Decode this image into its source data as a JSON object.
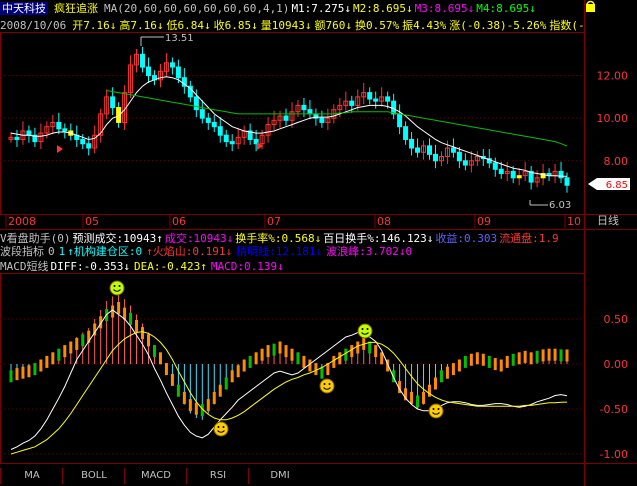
{
  "header": {
    "stock_name": "中天科技",
    "indicator": "疯狂追涨",
    "ma_params": "MA(20,60,60,60,60,60,60,4,1)",
    "m1": "M1:7.275↓",
    "m2": "M2:8.695↓",
    "m3": "M3:8.695↓",
    "m4": "M4:8.695↓",
    "date": "2008/10/06",
    "open": "开7.16↓",
    "high": "高7.16↓",
    "low": "低6.84↓",
    "close": "收6.85↓",
    "volume": "量10943↓",
    "amount": "额760↓",
    "turnover": "换0.57%",
    "amplitude": "振4.43%",
    "change": "涨(-0.38)-5.26%",
    "index_label": "指数(-"
  },
  "info1": {
    "label": "V看盘助手(0)",
    "forecast": "预测成交:10943↑",
    "deal": "成交:10943↓",
    "turnover_rate": "换手率%:0.568↓",
    "hundred_day": "百日换手%:146.123↓",
    "profit": "收益:0.303",
    "float_shares": "流通盘:1.9"
  },
  "info2": {
    "label": "波段指标",
    "zero": "0",
    "one": "1",
    "inst_build": "↑机构建仓区:0",
    "fire": "↑火焰山:0.191↓",
    "bottom": "精明线:12.181↓",
    "wave_peak": "波浪峰:3.702↓0"
  },
  "macd_info": {
    "label": "MACD短线",
    "diff": "DIFF:-0.353↓",
    "dea": "DEA:-0.423↑",
    "macd": "MACD:0.139↓"
  },
  "tabs": [
    "MA",
    "BOLL",
    "MACD",
    "RSI",
    "DMI"
  ],
  "right_label": "日线",
  "price_tag": "6.85",
  "annotations": {
    "high": "13.51",
    "low": "6.03"
  },
  "colors": {
    "up": "#ff3232",
    "down": "#00ffff",
    "ma_white": "#ffffff",
    "ma_green": "#00c000",
    "macd_white": "#ffffff",
    "macd_yellow": "#ffff00"
  },
  "chart_data": [
    {
      "type": "candlestick",
      "yticks": [
        "12.00",
        "10.00",
        "8.00"
      ],
      "ylim": [
        5.5,
        14.0
      ],
      "xticks": [
        "2008",
        "05",
        "06",
        "07",
        "08",
        "09",
        "10"
      ],
      "series": [
        {
          "values": [
            9.1,
            9.0,
            9.4,
            9.2,
            8.9,
            9.3,
            9.6,
            9.8,
            9.5,
            9.4,
            9.2,
            9.0,
            8.8,
            8.6,
            9.2,
            10.2,
            11.0,
            10.5,
            9.8,
            11.2,
            12.5,
            13.0,
            12.4,
            12.0,
            11.8,
            12.2,
            12.6,
            12.4,
            11.9,
            11.5,
            11.0,
            10.4,
            10.0,
            9.8,
            9.6,
            9.2,
            8.9,
            8.8,
            9.1,
            9.4,
            9.0,
            8.8,
            9.2,
            9.7,
            9.9,
            10.1,
            9.9,
            10.3,
            10.6,
            10.4,
            10.2,
            10.0,
            9.8,
            10.0,
            10.4,
            10.6,
            10.8,
            10.6,
            11.0,
            11.2,
            10.9,
            10.8,
            11.0,
            10.8,
            10.2,
            9.6,
            9.0,
            8.6,
            8.4,
            8.7,
            8.3,
            8.0,
            8.2,
            8.6,
            8.4,
            8.0,
            7.8,
            8.0,
            8.2,
            8.1,
            7.9,
            7.6,
            7.4,
            7.5,
            7.2,
            7.3,
            7.5,
            7.0,
            7.2,
            7.4,
            7.3,
            7.5,
            7.2,
            6.85
          ]
        },
        {
          "name": "MA",
          "values": [
            9.3,
            9.25,
            9.2,
            9.2,
            9.15,
            9.15,
            9.2,
            9.3,
            9.35,
            9.35,
            9.3,
            9.2,
            9.1,
            9.0,
            9.05,
            9.3,
            9.7,
            10.0,
            10.1,
            10.4,
            10.8,
            11.2,
            11.5,
            11.7,
            11.8,
            11.9,
            11.95,
            11.9,
            11.8,
            11.6,
            11.4,
            11.1,
            10.8,
            10.5,
            10.2,
            10.0,
            9.8,
            9.6,
            9.5,
            9.4,
            9.35,
            9.3,
            9.3,
            9.35,
            9.4,
            9.5,
            9.6,
            9.7,
            9.8,
            9.9,
            10.0,
            10.05,
            10.05,
            10.05,
            10.1,
            10.2,
            10.3,
            10.4,
            10.5,
            10.55,
            10.6,
            10.6,
            10.6,
            10.55,
            10.45,
            10.3,
            10.1,
            9.85,
            9.6,
            9.4,
            9.2,
            9.0,
            8.85,
            8.75,
            8.65,
            8.55,
            8.45,
            8.35,
            8.25,
            8.15,
            8.05,
            7.95,
            7.85,
            7.75,
            7.65,
            7.6,
            7.55,
            7.45,
            7.4,
            7.35,
            7.3,
            7.3,
            7.28,
            7.275
          ]
        },
        {
          "name": "MA",
          "values": [
            null,
            null,
            null,
            null,
            null,
            null,
            null,
            null,
            null,
            null,
            null,
            null,
            null,
            null,
            null,
            null,
            11.3,
            11.25,
            11.2,
            11.15,
            11.1,
            11.05,
            11.0,
            10.95,
            10.9,
            10.85,
            10.8,
            10.75,
            10.7,
            10.65,
            10.6,
            10.55,
            10.5,
            10.45,
            10.4,
            10.35,
            10.3,
            10.25,
            10.2,
            10.2,
            10.2,
            10.2,
            10.2,
            10.2,
            10.2,
            10.2,
            10.2,
            10.2,
            10.2,
            10.2,
            10.2,
            10.2,
            10.2,
            10.2,
            10.2,
            10.25,
            10.25,
            10.3,
            10.3,
            10.3,
            10.3,
            10.3,
            10.3,
            10.3,
            10.25,
            10.2,
            10.15,
            10.1,
            10.05,
            10.0,
            9.95,
            9.9,
            9.85,
            9.8,
            9.75,
            9.7,
            9.65,
            9.6,
            9.55,
            9.5,
            9.45,
            9.4,
            9.35,
            9.3,
            9.25,
            9.2,
            9.15,
            9.1,
            9.05,
            9.0,
            8.95,
            8.9,
            8.8,
            8.695
          ]
        }
      ]
    },
    {
      "type": "bar",
      "yticks": [
        "0.50",
        "0.00",
        "-0.50",
        "-1.00"
      ],
      "ylim": [
        -1.1,
        1.0
      ],
      "series": [
        {
          "name": "MACD",
          "values": [
            -0.15,
            -0.12,
            -0.1,
            -0.08,
            -0.05,
            0.0,
            0.05,
            0.1,
            0.15,
            0.2,
            0.25,
            0.3,
            0.35,
            0.4,
            0.5,
            0.6,
            0.7,
            0.75,
            0.8,
            0.72,
            0.65,
            0.55,
            0.45,
            0.35,
            0.2,
            0.1,
            -0.05,
            -0.2,
            -0.35,
            -0.45,
            -0.55,
            -0.6,
            -0.62,
            -0.55,
            -0.45,
            -0.35,
            -0.25,
            -0.15,
            -0.08,
            0.0,
            0.05,
            0.1,
            0.15,
            0.2,
            0.22,
            0.25,
            0.2,
            0.15,
            0.1,
            0.05,
            0.0,
            -0.05,
            -0.1,
            -0.05,
            0.05,
            0.1,
            0.15,
            0.2,
            0.25,
            0.3,
            0.25,
            0.2,
            0.1,
            0.0,
            -0.15,
            -0.3,
            -0.4,
            -0.45,
            -0.5,
            -0.45,
            -0.35,
            -0.25,
            -0.15,
            -0.1,
            -0.05,
            0.0,
            0.05,
            0.08,
            0.1,
            0.08,
            0.05,
            0.02,
            0.0,
            0.05,
            0.08,
            0.1,
            0.12,
            0.1,
            0.12,
            0.14,
            0.15,
            0.15,
            0.14,
            0.139
          ]
        },
        {
          "name": "DIFF",
          "values": [
            -0.95,
            -0.92,
            -0.88,
            -0.85,
            -0.8,
            -0.72,
            -0.62,
            -0.5,
            -0.38,
            -0.25,
            -0.1,
            0.05,
            0.15,
            0.25,
            0.35,
            0.45,
            0.55,
            0.6,
            0.55,
            0.5,
            0.42,
            0.32,
            0.22,
            0.1,
            -0.05,
            -0.18,
            -0.32,
            -0.45,
            -0.58,
            -0.68,
            -0.76,
            -0.8,
            -0.82,
            -0.78,
            -0.7,
            -0.62,
            -0.55,
            -0.48,
            -0.4,
            -0.35,
            -0.3,
            -0.25,
            -0.2,
            -0.15,
            -0.1,
            -0.08,
            -0.1,
            -0.12,
            -0.1,
            -0.05,
            0.0,
            0.05,
            0.1,
            0.15,
            0.2,
            0.25,
            0.3,
            0.32,
            0.35,
            0.35,
            0.3,
            0.25,
            0.15,
            0.0,
            -0.15,
            -0.28,
            -0.38,
            -0.45,
            -0.5,
            -0.52,
            -0.52,
            -0.5,
            -0.46,
            -0.43,
            -0.42,
            -0.42,
            -0.43,
            -0.45,
            -0.46,
            -0.46,
            -0.45,
            -0.44,
            -0.44,
            -0.45,
            -0.47,
            -0.48,
            -0.47,
            -0.45,
            -0.42,
            -0.4,
            -0.38,
            -0.35,
            -0.34,
            -0.353
          ]
        },
        {
          "name": "DEA",
          "values": [
            -1.0,
            -0.98,
            -0.96,
            -0.94,
            -0.92,
            -0.88,
            -0.84,
            -0.78,
            -0.72,
            -0.64,
            -0.55,
            -0.45,
            -0.35,
            -0.25,
            -0.15,
            -0.05,
            0.05,
            0.15,
            0.22,
            0.28,
            0.32,
            0.35,
            0.36,
            0.34,
            0.3,
            0.24,
            0.16,
            0.05,
            -0.08,
            -0.2,
            -0.32,
            -0.42,
            -0.5,
            -0.56,
            -0.6,
            -0.62,
            -0.62,
            -0.6,
            -0.57,
            -0.53,
            -0.48,
            -0.43,
            -0.38,
            -0.33,
            -0.28,
            -0.24,
            -0.2,
            -0.17,
            -0.15,
            -0.12,
            -0.1,
            -0.07,
            -0.04,
            0.0,
            0.04,
            0.08,
            0.12,
            0.16,
            0.2,
            0.22,
            0.24,
            0.24,
            0.22,
            0.18,
            0.12,
            0.04,
            -0.05,
            -0.14,
            -0.22,
            -0.28,
            -0.33,
            -0.37,
            -0.4,
            -0.42,
            -0.43,
            -0.44,
            -0.45,
            -0.46,
            -0.47,
            -0.47,
            -0.47,
            -0.47,
            -0.47,
            -0.47,
            -0.47,
            -0.47,
            -0.46,
            -0.46,
            -0.45,
            -0.44,
            -0.43,
            -0.43,
            -0.425,
            -0.423
          ]
        }
      ]
    }
  ]
}
